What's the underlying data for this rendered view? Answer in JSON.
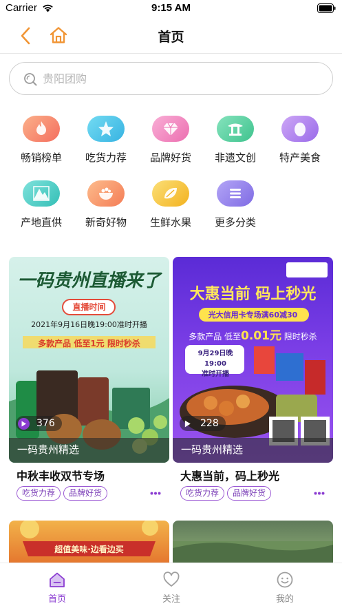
{
  "status_bar": {
    "carrier": "Carrier",
    "time": "9:15 AM"
  },
  "nav": {
    "title": "首页"
  },
  "search": {
    "placeholder": "贵阳团购"
  },
  "categories": [
    {
      "label": "畅销榜单",
      "color": "#f7896a",
      "icon": "flame-icon"
    },
    {
      "label": "吃货力荐",
      "color": "#4fc7e8",
      "icon": "star-icon"
    },
    {
      "label": "品牌好货",
      "color": "#f38ec6",
      "icon": "diamond-icon"
    },
    {
      "label": "非遗文创",
      "color": "#5fd2a4",
      "icon": "pavilion-icon"
    },
    {
      "label": "特产美食",
      "color": "#b688f0",
      "icon": "egg-icon"
    },
    {
      "label": "产地直供",
      "color": "#56d2c8",
      "icon": "mountain-icon"
    },
    {
      "label": "新奇好物",
      "color": "#fa9f73",
      "icon": "bowl-icon"
    },
    {
      "label": "生鲜水果",
      "color": "#f6c84a",
      "icon": "fruit-icon"
    },
    {
      "label": "更多分类",
      "color": "#9b89ee",
      "icon": "menu-icon"
    }
  ],
  "cards": [
    {
      "views": "376",
      "channel": "一码贵州精选",
      "title": "中秋丰收双节专场",
      "tags": [
        "吃货力荐",
        "品牌好货"
      ],
      "poster": {
        "headline": "一码贵州直播来了",
        "badge": "直播时间",
        "date_line": "2021年9月16日晚19:00准时开播",
        "promo": "多款产品 低至1元 限时秒杀"
      }
    },
    {
      "views": "228",
      "channel": "一码贵州精选",
      "title": "大惠当前，码上秒光",
      "tags": [
        "吃货力荐",
        "品牌好货"
      ],
      "poster": {
        "headline": "大惠当前 码上秒光",
        "sub": "光大信用卡专场满60减30",
        "promo_pre": "多款产品 低至",
        "promo_price": "0.01元",
        "promo_post": "限时秒杀",
        "date_line1": "9月29日晚19:00",
        "date_line2": "准时开播"
      }
    }
  ],
  "partial_card": {
    "banner": "超值美味·边看边买"
  },
  "tabs": [
    {
      "label": "首页",
      "active": true,
      "icon": "home-icon"
    },
    {
      "label": "关注",
      "active": false,
      "icon": "heart-icon"
    },
    {
      "label": "我的",
      "active": false,
      "icon": "smiley-icon"
    }
  ],
  "colors": {
    "accent": "#8a3bd1",
    "nav_icon": "#f19535",
    "tab_inactive": "#a0a0a0"
  }
}
